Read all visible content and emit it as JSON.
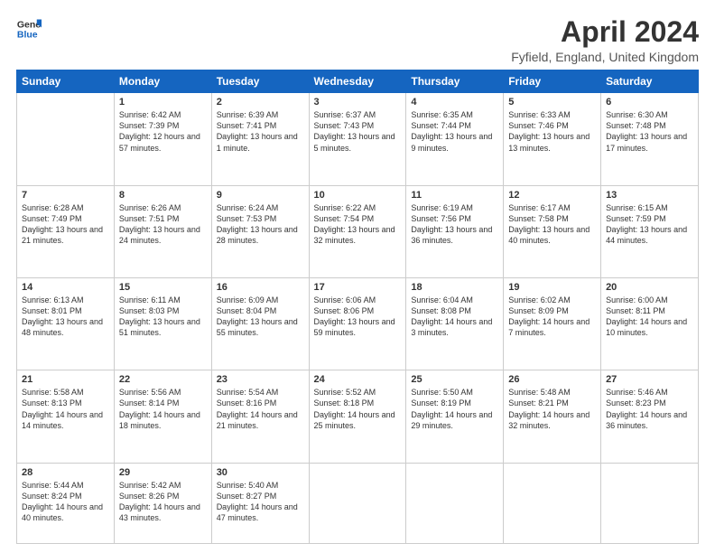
{
  "header": {
    "logo_general": "General",
    "logo_blue": "Blue",
    "title": "April 2024",
    "subtitle": "Fyfield, England, United Kingdom"
  },
  "weekdays": [
    "Sunday",
    "Monday",
    "Tuesday",
    "Wednesday",
    "Thursday",
    "Friday",
    "Saturday"
  ],
  "weeks": [
    [
      {
        "num": "",
        "sunrise": "",
        "sunset": "",
        "daylight": ""
      },
      {
        "num": "1",
        "sunrise": "Sunrise: 6:42 AM",
        "sunset": "Sunset: 7:39 PM",
        "daylight": "Daylight: 12 hours and 57 minutes."
      },
      {
        "num": "2",
        "sunrise": "Sunrise: 6:39 AM",
        "sunset": "Sunset: 7:41 PM",
        "daylight": "Daylight: 13 hours and 1 minute."
      },
      {
        "num": "3",
        "sunrise": "Sunrise: 6:37 AM",
        "sunset": "Sunset: 7:43 PM",
        "daylight": "Daylight: 13 hours and 5 minutes."
      },
      {
        "num": "4",
        "sunrise": "Sunrise: 6:35 AM",
        "sunset": "Sunset: 7:44 PM",
        "daylight": "Daylight: 13 hours and 9 minutes."
      },
      {
        "num": "5",
        "sunrise": "Sunrise: 6:33 AM",
        "sunset": "Sunset: 7:46 PM",
        "daylight": "Daylight: 13 hours and 13 minutes."
      },
      {
        "num": "6",
        "sunrise": "Sunrise: 6:30 AM",
        "sunset": "Sunset: 7:48 PM",
        "daylight": "Daylight: 13 hours and 17 minutes."
      }
    ],
    [
      {
        "num": "7",
        "sunrise": "Sunrise: 6:28 AM",
        "sunset": "Sunset: 7:49 PM",
        "daylight": "Daylight: 13 hours and 21 minutes."
      },
      {
        "num": "8",
        "sunrise": "Sunrise: 6:26 AM",
        "sunset": "Sunset: 7:51 PM",
        "daylight": "Daylight: 13 hours and 24 minutes."
      },
      {
        "num": "9",
        "sunrise": "Sunrise: 6:24 AM",
        "sunset": "Sunset: 7:53 PM",
        "daylight": "Daylight: 13 hours and 28 minutes."
      },
      {
        "num": "10",
        "sunrise": "Sunrise: 6:22 AM",
        "sunset": "Sunset: 7:54 PM",
        "daylight": "Daylight: 13 hours and 32 minutes."
      },
      {
        "num": "11",
        "sunrise": "Sunrise: 6:19 AM",
        "sunset": "Sunset: 7:56 PM",
        "daylight": "Daylight: 13 hours and 36 minutes."
      },
      {
        "num": "12",
        "sunrise": "Sunrise: 6:17 AM",
        "sunset": "Sunset: 7:58 PM",
        "daylight": "Daylight: 13 hours and 40 minutes."
      },
      {
        "num": "13",
        "sunrise": "Sunrise: 6:15 AM",
        "sunset": "Sunset: 7:59 PM",
        "daylight": "Daylight: 13 hours and 44 minutes."
      }
    ],
    [
      {
        "num": "14",
        "sunrise": "Sunrise: 6:13 AM",
        "sunset": "Sunset: 8:01 PM",
        "daylight": "Daylight: 13 hours and 48 minutes."
      },
      {
        "num": "15",
        "sunrise": "Sunrise: 6:11 AM",
        "sunset": "Sunset: 8:03 PM",
        "daylight": "Daylight: 13 hours and 51 minutes."
      },
      {
        "num": "16",
        "sunrise": "Sunrise: 6:09 AM",
        "sunset": "Sunset: 8:04 PM",
        "daylight": "Daylight: 13 hours and 55 minutes."
      },
      {
        "num": "17",
        "sunrise": "Sunrise: 6:06 AM",
        "sunset": "Sunset: 8:06 PM",
        "daylight": "Daylight: 13 hours and 59 minutes."
      },
      {
        "num": "18",
        "sunrise": "Sunrise: 6:04 AM",
        "sunset": "Sunset: 8:08 PM",
        "daylight": "Daylight: 14 hours and 3 minutes."
      },
      {
        "num": "19",
        "sunrise": "Sunrise: 6:02 AM",
        "sunset": "Sunset: 8:09 PM",
        "daylight": "Daylight: 14 hours and 7 minutes."
      },
      {
        "num": "20",
        "sunrise": "Sunrise: 6:00 AM",
        "sunset": "Sunset: 8:11 PM",
        "daylight": "Daylight: 14 hours and 10 minutes."
      }
    ],
    [
      {
        "num": "21",
        "sunrise": "Sunrise: 5:58 AM",
        "sunset": "Sunset: 8:13 PM",
        "daylight": "Daylight: 14 hours and 14 minutes."
      },
      {
        "num": "22",
        "sunrise": "Sunrise: 5:56 AM",
        "sunset": "Sunset: 8:14 PM",
        "daylight": "Daylight: 14 hours and 18 minutes."
      },
      {
        "num": "23",
        "sunrise": "Sunrise: 5:54 AM",
        "sunset": "Sunset: 8:16 PM",
        "daylight": "Daylight: 14 hours and 21 minutes."
      },
      {
        "num": "24",
        "sunrise": "Sunrise: 5:52 AM",
        "sunset": "Sunset: 8:18 PM",
        "daylight": "Daylight: 14 hours and 25 minutes."
      },
      {
        "num": "25",
        "sunrise": "Sunrise: 5:50 AM",
        "sunset": "Sunset: 8:19 PM",
        "daylight": "Daylight: 14 hours and 29 minutes."
      },
      {
        "num": "26",
        "sunrise": "Sunrise: 5:48 AM",
        "sunset": "Sunset: 8:21 PM",
        "daylight": "Daylight: 14 hours and 32 minutes."
      },
      {
        "num": "27",
        "sunrise": "Sunrise: 5:46 AM",
        "sunset": "Sunset: 8:23 PM",
        "daylight": "Daylight: 14 hours and 36 minutes."
      }
    ],
    [
      {
        "num": "28",
        "sunrise": "Sunrise: 5:44 AM",
        "sunset": "Sunset: 8:24 PM",
        "daylight": "Daylight: 14 hours and 40 minutes."
      },
      {
        "num": "29",
        "sunrise": "Sunrise: 5:42 AM",
        "sunset": "Sunset: 8:26 PM",
        "daylight": "Daylight: 14 hours and 43 minutes."
      },
      {
        "num": "30",
        "sunrise": "Sunrise: 5:40 AM",
        "sunset": "Sunset: 8:27 PM",
        "daylight": "Daylight: 14 hours and 47 minutes."
      },
      {
        "num": "",
        "sunrise": "",
        "sunset": "",
        "daylight": ""
      },
      {
        "num": "",
        "sunrise": "",
        "sunset": "",
        "daylight": ""
      },
      {
        "num": "",
        "sunrise": "",
        "sunset": "",
        "daylight": ""
      },
      {
        "num": "",
        "sunrise": "",
        "sunset": "",
        "daylight": ""
      }
    ]
  ]
}
